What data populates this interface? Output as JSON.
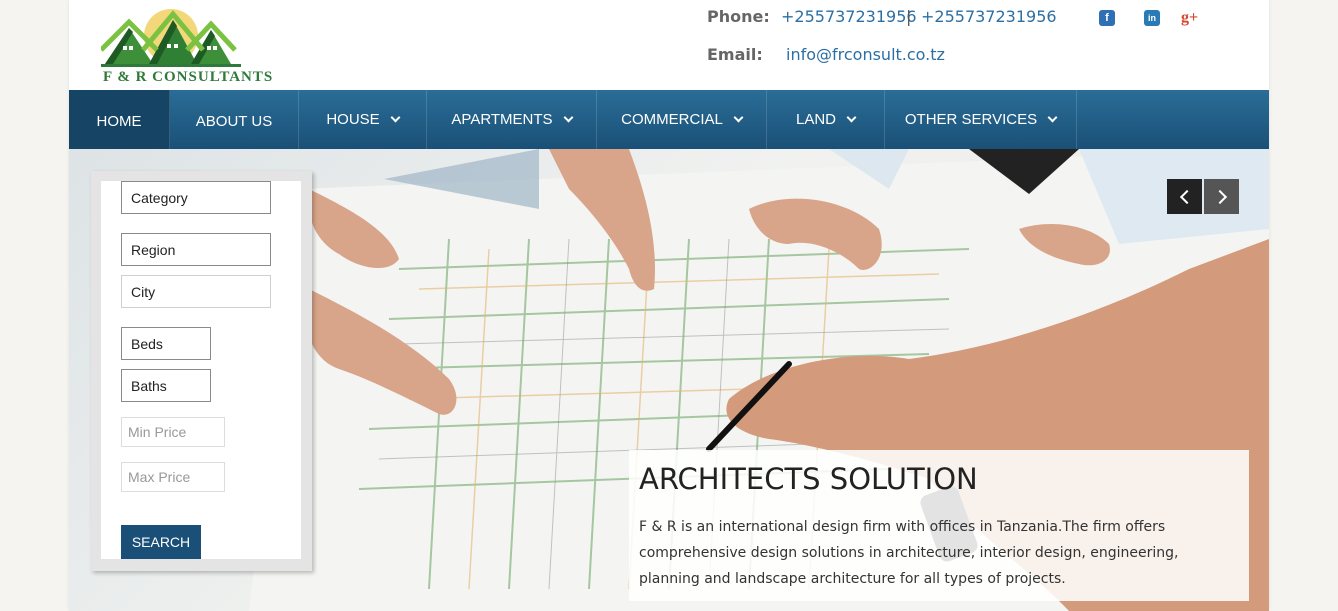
{
  "brand": {
    "name": "F & R CONSULTANTS",
    "green": "#2e7a3a",
    "accent": "#1a5077"
  },
  "contact": {
    "phone_label": "Phone:",
    "phone_1": "+255737231956",
    "separator": "|",
    "phone_2": "+255737231956",
    "email_label": "Email:",
    "email": "info@frconsult.co.tz"
  },
  "social": [
    {
      "icon": "facebook-icon",
      "glyph": "f",
      "color": "#2f6fb3"
    },
    {
      "icon": "linkedin-icon",
      "glyph": "in",
      "color": "#2a7ab6"
    },
    {
      "icon": "google-plus-icon",
      "glyph": "g+",
      "color": "#d6482f"
    }
  ],
  "nav": {
    "items": [
      {
        "label": "HOME",
        "dropdown": false,
        "active": true
      },
      {
        "label": "ABOUT US",
        "dropdown": false
      },
      {
        "label": "HOUSE",
        "dropdown": true
      },
      {
        "label": "APARTMENTS",
        "dropdown": true
      },
      {
        "label": "COMMERCIAL",
        "dropdown": true
      },
      {
        "label": "LAND",
        "dropdown": true
      },
      {
        "label": "OTHER SERVICES",
        "dropdown": true
      }
    ]
  },
  "search": {
    "category": "Category",
    "region": "Region",
    "city": "City",
    "beds": "Beds",
    "baths": "Baths",
    "min_price_placeholder": "Min Price",
    "max_price_placeholder": "Max Price",
    "button": "SEARCH"
  },
  "slider": {
    "prev_icon": "chevron-left-icon",
    "next_icon": "chevron-right-icon",
    "caption_title": "ARCHITECTS SOLUTION",
    "caption_text": "F & R is an international design firm with offices in Tanzania.The firm offers comprehensive design solutions in architecture, interior design, engineering, planning and landscape architecture for all types of projects."
  }
}
